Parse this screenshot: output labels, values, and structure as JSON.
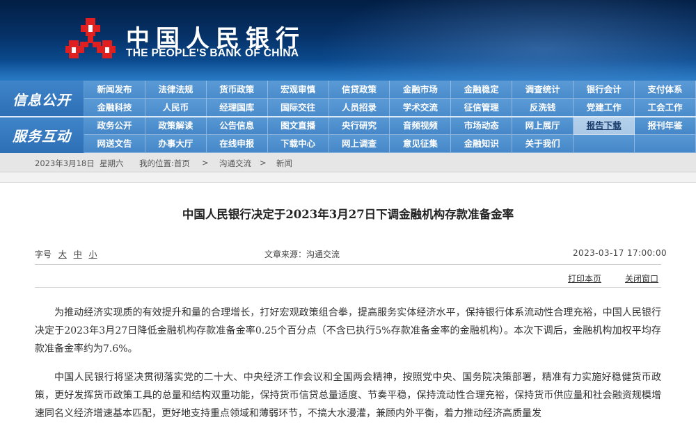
{
  "header": {
    "title_cn": "中国人民银行",
    "title_en": "THE PEOPLE'S BANK OF CHINA",
    "logo_color": "#e02020"
  },
  "nav": {
    "side": [
      "信息公开",
      "服务互动"
    ],
    "rows": [
      [
        "新闻发布",
        "法律法规",
        "货币政策",
        "宏观审慎",
        "信贷政策",
        "金融市场",
        "金融稳定",
        "调查统计",
        "银行会计",
        "支付体系"
      ],
      [
        "金融科技",
        "人民币",
        "经理国库",
        "国际交往",
        "人员招录",
        "学术交流",
        "征信管理",
        "反洗钱",
        "党建工作",
        "工会工作"
      ],
      [
        "政务公开",
        "政策解读",
        "公告信息",
        "图文直播",
        "央行研究",
        "音频视频",
        "市场动态",
        "网上展厅",
        "报告下载",
        "报刊年鉴"
      ],
      [
        "网送文告",
        "办事大厅",
        "在线申报",
        "下载中心",
        "网上调查",
        "意见征集",
        "金融知识",
        "关于我们",
        "",
        ""
      ]
    ],
    "selected": "报告下载"
  },
  "breadcrumb": {
    "date": "2023年3月18日",
    "weekday": "星期六",
    "location_label": "我的位置:首页",
    "sep1": ">",
    "level1": "沟通交流",
    "sep2": ">",
    "level2": "新闻"
  },
  "article": {
    "title": "中国人民银行决定于2023年3月27日下调金融机构存款准备金率",
    "font_label": "字号",
    "font_large": "大",
    "font_medium": "中",
    "font_small": "小",
    "source": "文章来源：沟通交流",
    "datetime": "2023-03-17  17:00:00",
    "print_label": "打印本页",
    "close_label": "关闭窗口",
    "paragraphs": [
      "为推动经济实现质的有效提升和量的合理增长，打好宏观政策组合拳，提高服务实体经济水平，保持银行体系流动性合理充裕，中国人民银行决定于2023年3月27日降低金融机构存款准备金率0.25个百分点（不含已执行5%存款准备金率的金融机构）。本次下调后，金融机构加权平均存款准备金率约为7.6%。",
      "中国人民银行将坚决贯彻落实党的二十大、中央经济工作会议和全国两会精神，按照党中央、国务院决策部署，精准有力实施好稳健货币政策，更好发挥货币政策工具的总量和结构双重功能，保持货币信贷总量适度、节奏平稳，保持流动性合理充裕，保持货币供应量和社会融资规模增速同名义经济增速基本匹配，更好地支持重点领域和薄弱环节，不搞大水漫灌，兼顾内外平衡，着力推动经济高质量发"
    ]
  }
}
